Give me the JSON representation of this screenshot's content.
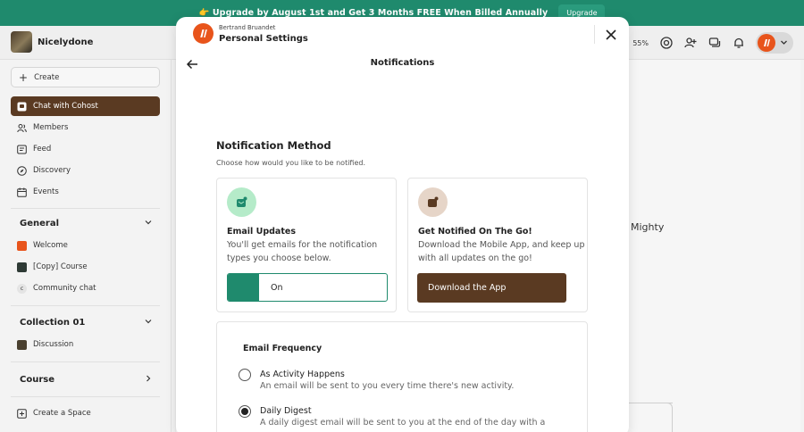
{
  "banner": {
    "text": "👉 Upgrade by August 1st and Get 3 Months FREE When Billed Annually",
    "button": "Upgrade"
  },
  "header": {
    "community_name": "Nicelydone",
    "progress_label": "55%"
  },
  "sidebar": {
    "create_label": "Create",
    "items": [
      {
        "label": "Chat with Cohost",
        "icon": "chat-icon"
      },
      {
        "label": "Members",
        "icon": "members-icon"
      },
      {
        "label": "Feed",
        "icon": "feed-icon"
      },
      {
        "label": "Discovery",
        "icon": "compass-icon"
      },
      {
        "label": "Events",
        "icon": "calendar-icon"
      }
    ],
    "sections": [
      {
        "title": "General",
        "items": [
          "Welcome",
          "[Copy] Course",
          "Community chat"
        ]
      },
      {
        "title": "Collection 01",
        "items": [
          "Discussion"
        ]
      },
      {
        "title": "Course",
        "items": []
      }
    ],
    "create_space": "Create a Space"
  },
  "background": {
    "mighty_text": "Mighty"
  },
  "modal": {
    "user_name": "Bertrand Bruandet",
    "title": "Personal Settings",
    "page_title": "Notifications",
    "method_title": "Notification Method",
    "method_subtitle": "Choose how would you like to be notified.",
    "email_card": {
      "title": "Email Updates",
      "description": "You'll get emails for the notification types you choose below.",
      "toggle_label": "On"
    },
    "app_card": {
      "title": "Get Notified On The Go!",
      "description": "Download the Mobile App, and keep up with all updates on the go!",
      "button": "Download the App"
    },
    "frequency": {
      "title": "Email Frequency",
      "options": [
        {
          "title": "As Activity Happens",
          "description": "An email will be sent to you every time there's new activity.",
          "selected": false
        },
        {
          "title": "Daily Digest",
          "description": "A daily digest email will be sent to you at the end of the day with a",
          "selected": true
        }
      ]
    }
  },
  "colors": {
    "banner": "#1f8a6d",
    "accent_brown": "#5a3a22",
    "brand_orange": "#e8541b",
    "toggle_green": "#1f8a6d"
  }
}
